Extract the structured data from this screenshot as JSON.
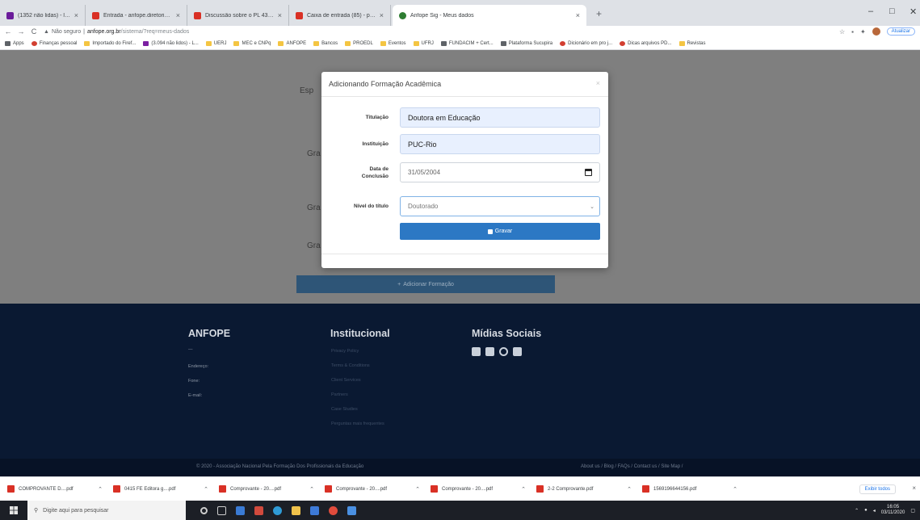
{
  "browser": {
    "tabs": [
      {
        "label": "(1352 não lidas) - luciane...",
        "favicon_color": "#6a1b9a"
      },
      {
        "label": "Entrada - anfope.diretoria@gm...",
        "favicon_color": "#d93025"
      },
      {
        "label": "Discussão sobre o PL 4372/2019 - ...",
        "favicon_color": "#d93025"
      },
      {
        "label": "Caixa de entrada (85) - prof.luc...",
        "favicon_color": "#d93025"
      },
      {
        "label": "Anfope Sig - Meus dados",
        "favicon_color": "#2e7d32"
      }
    ],
    "new_tab_glyph": "+",
    "window_controls": [
      "–",
      "□",
      "✕"
    ],
    "nav": {
      "back": "←",
      "forward": "→",
      "reload": "C"
    },
    "address": {
      "security_label": "Não seguro",
      "host": "anfope.org.br",
      "path": "/sistema/?req=meus-dados"
    },
    "update_label": "Atualizar",
    "bookmarks": [
      {
        "label": "Apps",
        "icon": "apps-grid-icon"
      },
      {
        "label": "Finanças pessoal",
        "icon": "red-icon"
      },
      {
        "label": "Importado do Firef...",
        "icon": "folder-icon"
      },
      {
        "label": "(3.094 não lidos) - L...",
        "icon": "mail-icon"
      },
      {
        "label": "UERJ",
        "icon": "folder-icon"
      },
      {
        "label": "MEC e CNPq",
        "icon": "folder-icon"
      },
      {
        "label": "ANFOPE",
        "icon": "folder-icon"
      },
      {
        "label": "Bancos",
        "icon": "folder-icon"
      },
      {
        "label": "PROEDL",
        "icon": "folder-icon"
      },
      {
        "label": "Eventos",
        "icon": "folder-icon"
      },
      {
        "label": "UFRJ",
        "icon": "folder-icon"
      },
      {
        "label": "FUNDACIM + Cert...",
        "icon": "doc-icon"
      },
      {
        "label": "Plataforma Sucupira",
        "icon": "doc-icon"
      },
      {
        "label": "Dicionário em pro j...",
        "icon": "red-icon"
      },
      {
        "label": "Dicas arquivos PD...",
        "icon": "red-icon"
      },
      {
        "label": "Revistas",
        "icon": "folder-icon"
      }
    ]
  },
  "page": {
    "side_labels": [
      "Esp",
      "Gra",
      "Gra",
      "Gra"
    ],
    "add_button_label": "Adicionar Formação"
  },
  "modal": {
    "title": "Adicionando Formação Acadêmica",
    "close_glyph": "×",
    "fields": {
      "titulacao": {
        "label": "Titulação",
        "value": "Doutora em Educação"
      },
      "instituicao": {
        "label": "Instituição",
        "value": "PUC-Rio"
      },
      "data_conclusao": {
        "label_line1": "Data de",
        "label_line2": "Conclusão",
        "value": "31/05/2004"
      },
      "nivel_titulo": {
        "label": "Nível do título",
        "value": "Doutorado"
      }
    },
    "save_label": "Gravar"
  },
  "footer": {
    "brand": "ANFOPE",
    "brand_tagline": "—",
    "contact": [
      "Endereço:",
      "Fone:",
      "E-mail:"
    ],
    "institucional_title": "Institucional",
    "institucional_links": [
      "Privacy Policy",
      "Terms & Conditions",
      "Client Services",
      "Partners",
      "Case Studies",
      "Perguntas mais frequentes"
    ],
    "social_title": "Mídias Sociais",
    "copyright": "© 2020 - Associação Nacional Pela Formação Dos Profissionais da Educação",
    "bottom_links": "About us / Blog / FAQs / Contact us / Site Map /"
  },
  "downloads": {
    "items": [
      "COMPROVANTE D....pdf",
      "0415 FE Editora g....pdf",
      "Comprovante - 20....pdf",
      "Comprovante - 20....pdf",
      "Comprovante - 20....pdf",
      "2-2 Comprovante.pdf",
      "1569196644156.pdf"
    ],
    "show_all": "Exibir todos",
    "close": "×"
  },
  "taskbar": {
    "search_placeholder": "Digite aqui para pesquisar",
    "time": "16:05",
    "date": "03/11/2020"
  }
}
